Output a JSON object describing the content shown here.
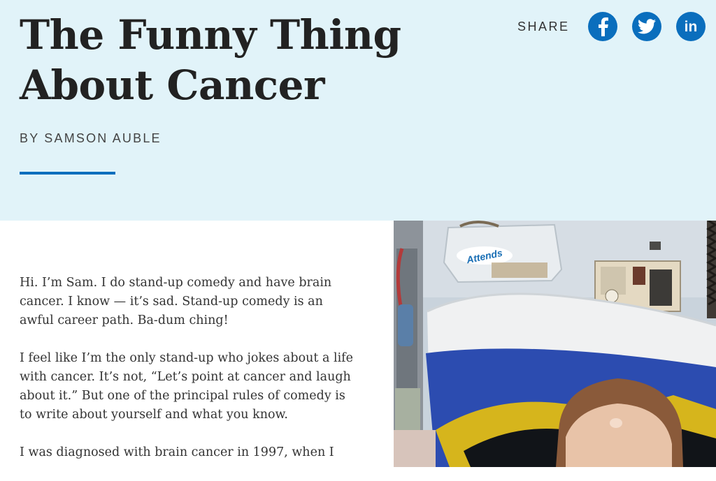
{
  "header": {
    "title_line1": "The Funny Thing",
    "title_line2": "About Cancer",
    "byline": "BY SAMSON AUBLE"
  },
  "share": {
    "label": "SHARE",
    "networks": [
      {
        "name": "Facebook",
        "icon": "facebook-icon"
      },
      {
        "name": "Twitter",
        "icon": "twitter-icon"
      },
      {
        "name": "LinkedIn",
        "icon": "linkedin-icon"
      }
    ],
    "linkedin_glyph": "in"
  },
  "article": {
    "paragraphs": [
      "Hi. I’m Sam. I do stand-up comedy and have brain cancer. I know — it’s sad. Stand-up comedy is an awful career path. Ba-dum ching!",
      "I feel like I’m the only stand-up who jokes about a life with cancer. It’s not, “Let’s point at cancer and laugh about it.” But one of the principal rules of comedy is to write about yourself and what you know.",
      "I was diagnosed with brain cancer in 1997, when I"
    ]
  },
  "photo": {
    "bag_text": "Attends"
  },
  "colors": {
    "hero_bg": "#e1f3f9",
    "accent": "#0a6ebd",
    "title": "#222222",
    "body_text": "#333333"
  }
}
